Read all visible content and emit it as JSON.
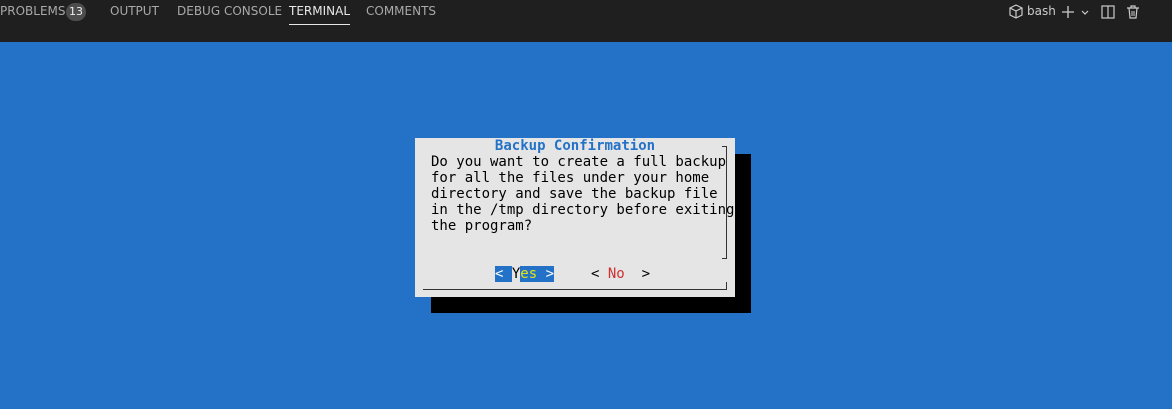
{
  "panel": {
    "tabs": [
      {
        "label": "PROBLEMS",
        "badge": "13"
      },
      {
        "label": "OUTPUT"
      },
      {
        "label": "DEBUG CONSOLE"
      },
      {
        "label": "TERMINAL",
        "active": true
      },
      {
        "label": "COMMENTS"
      }
    ],
    "shell": "bash",
    "actions": [
      "terminal-icon",
      "plus-icon",
      "chevron-down-icon",
      "split-icon",
      "trash-icon"
    ]
  },
  "dialog": {
    "title": "Backup Confirmation",
    "message": "Do you want to create a full backup\nfor all the files under your home\ndirectory and save the backup file\nin the /tmp directory before exiting\nthe program?",
    "yes": {
      "left": "< ",
      "cursor": "Y",
      "rest": "es",
      "right": " >"
    },
    "no": {
      "left": "< ",
      "hot": "No",
      "right": "  >"
    }
  },
  "colors": {
    "terminal_bg": "#2472c8",
    "dialog_bg": "#e5e5e5",
    "title": "#2472c8",
    "no_hotkey": "#cd3131",
    "panel_bg": "#1f1f1f"
  }
}
